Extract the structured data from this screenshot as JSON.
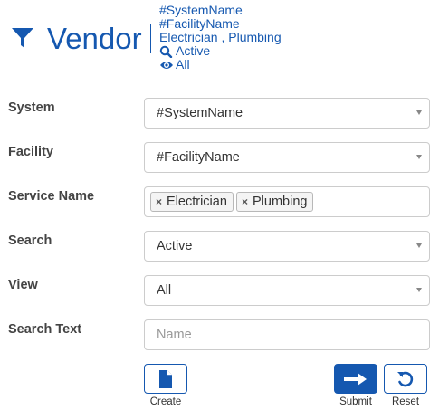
{
  "header": {
    "title": "Vendor",
    "summary": {
      "system": "#SystemName",
      "facility": "#FacilityName",
      "services": "Electrician , Plumbing",
      "search": "Active",
      "view": "All"
    }
  },
  "form": {
    "system": {
      "label": "System",
      "value": "#SystemName"
    },
    "facility": {
      "label": "Facility",
      "value": "#FacilityName"
    },
    "service_name": {
      "label": "Service Name",
      "tags": [
        "Electrician",
        "Plumbing"
      ]
    },
    "search": {
      "label": "Search",
      "value": "Active"
    },
    "view": {
      "label": "View",
      "value": "All"
    },
    "search_text": {
      "label": "Search Text",
      "value": "",
      "placeholder": "Name"
    }
  },
  "actions": {
    "create_label": "Create",
    "submit_label": "Submit",
    "reset_label": "Reset"
  },
  "colors": {
    "accent": "#1558b0",
    "border": "#cccccc"
  },
  "icons": {
    "title": "filter-icon",
    "search": "search-icon",
    "view": "eye-icon",
    "create": "file-icon",
    "submit": "arrow-right-icon",
    "reset": "undo-icon",
    "tag_remove": "close-icon",
    "select": "chevron-down-icon"
  }
}
